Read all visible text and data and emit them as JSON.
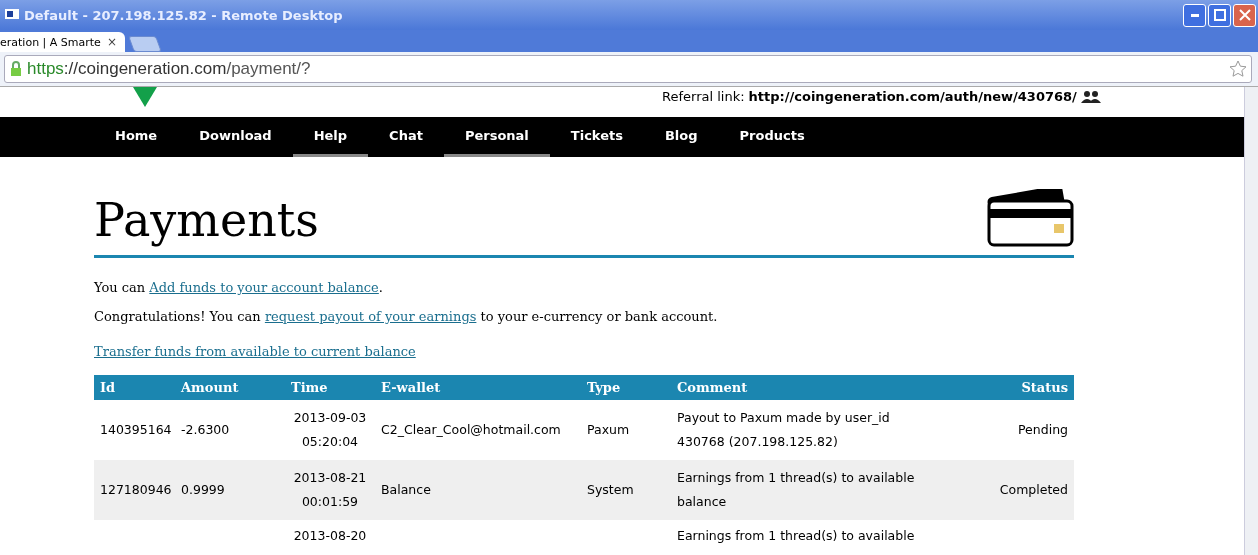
{
  "window": {
    "title": "Default - 207.198.125.82 - Remote Desktop"
  },
  "browser": {
    "tab_title": "eration | A Smarte",
    "tab_close": "×",
    "url_scheme": "https",
    "url_host": "://coingeneration.com",
    "url_path": "/payment/?"
  },
  "header": {
    "referral_label": "Referral link:",
    "referral_url": "http://coingeneration.com/auth/new/430768/"
  },
  "nav": [
    {
      "label": "Home",
      "submenu": false
    },
    {
      "label": "Download",
      "submenu": false
    },
    {
      "label": "Help",
      "submenu": true
    },
    {
      "label": "Chat",
      "submenu": false
    },
    {
      "label": "Personal",
      "submenu": true
    },
    {
      "label": "Tickets",
      "submenu": false
    },
    {
      "label": "Blog",
      "submenu": false
    },
    {
      "label": "Products",
      "submenu": false
    }
  ],
  "page": {
    "title": "Payments",
    "paragraphs": [
      {
        "before": "You can ",
        "link": "Add funds to your account balance",
        "after": "."
      },
      {
        "before": "Congratulations! You can ",
        "link": "request payout of your earnings",
        "after": " to your e-currency or bank account."
      },
      {
        "link": "Transfer funds from available to current balance"
      }
    ]
  },
  "table": {
    "columns": [
      "Id",
      "Amount",
      "Time",
      "E-wallet",
      "Type",
      "Comment",
      "Status"
    ],
    "rows": [
      {
        "id": "140395164",
        "amount": "-2.6300",
        "time": [
          "2013-09-03",
          "05:20:04"
        ],
        "ewallet": "C2_Clear_Cool@hotmail.com",
        "type": "Paxum",
        "comment": [
          "Payout to Paxum made by user_id",
          "430768 (207.198.125.82)"
        ],
        "status": "Pending"
      },
      {
        "id": "127180946",
        "amount": "0.9999",
        "time": [
          "2013-08-21",
          "00:01:59"
        ],
        "ewallet": "Balance",
        "type": "System",
        "comment": [
          "Earnings from 1 thread(s) to available",
          "balance"
        ],
        "status": "Completed"
      },
      {
        "time": [
          "2013-08-20"
        ],
        "comment": [
          "Earnings from 1 thread(s) to available"
        ]
      }
    ]
  }
}
